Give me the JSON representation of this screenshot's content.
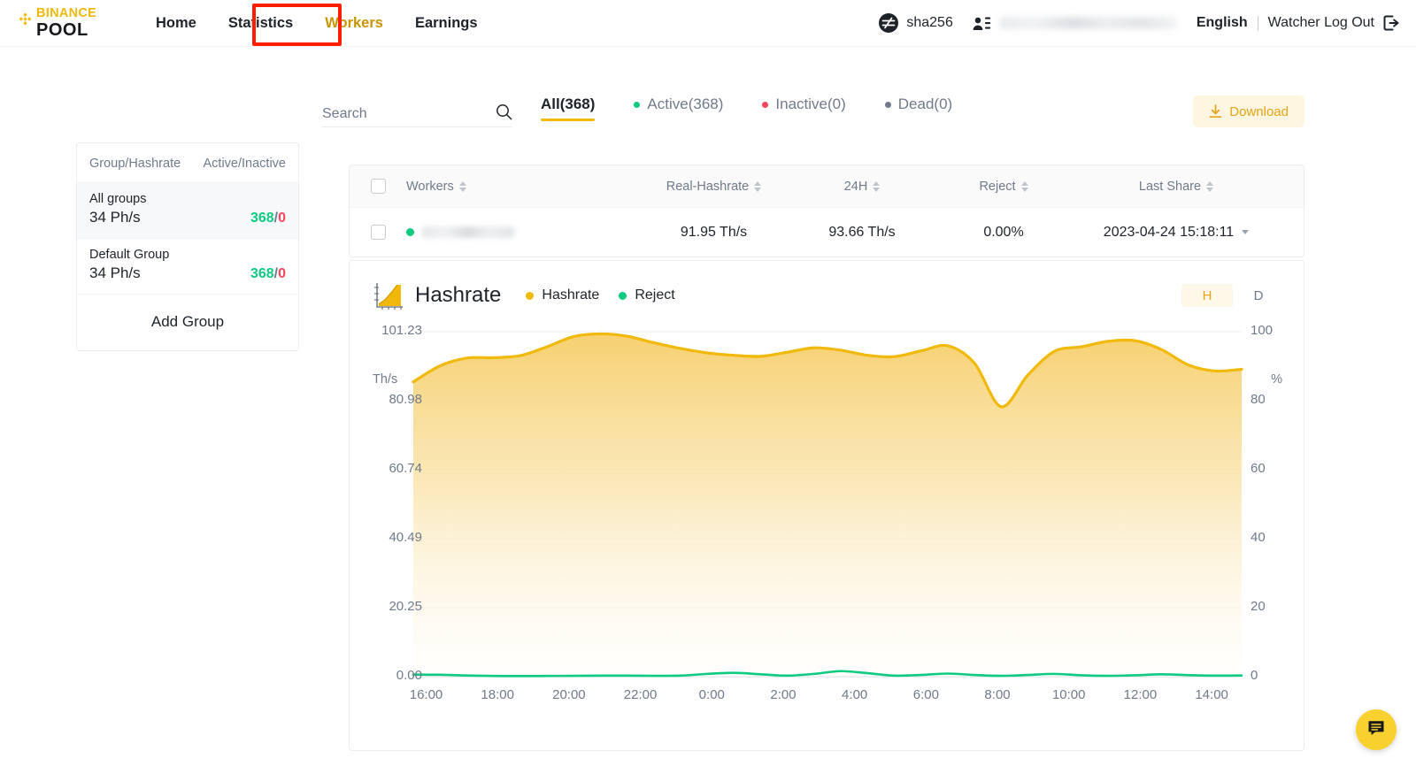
{
  "header": {
    "logo_top": "BINANCE",
    "logo_bottom": "POOL",
    "nav": [
      {
        "label": "Home",
        "active": false
      },
      {
        "label": "Statistics",
        "active": false
      },
      {
        "label": "Workers",
        "active": true
      },
      {
        "label": "Earnings",
        "active": false
      }
    ],
    "algorithm": "sha256",
    "account_masked": "",
    "language": "English",
    "logout": "Watcher Log Out",
    "highlight_color": "#FF1E00"
  },
  "toolbar": {
    "search_placeholder": "Search",
    "search_value": "",
    "tabs": [
      {
        "label": "All(368)",
        "dot": null,
        "active": true
      },
      {
        "label": "Active(368)",
        "dot": "#0ECB81",
        "active": false
      },
      {
        "label": "Inactive(0)",
        "dot": "#F6465D",
        "active": false
      },
      {
        "label": "Dead(0)",
        "dot": "#707a8a",
        "active": false
      }
    ],
    "download_label": "Download"
  },
  "sidebar": {
    "col_group": "Group/Hashrate",
    "col_active": "Active/Inactive",
    "groups": [
      {
        "name": "All groups",
        "hashrate": "34 Ph/s",
        "active": "368",
        "inactive": "0",
        "selected": true
      },
      {
        "name": "Default Group",
        "hashrate": "34 Ph/s",
        "active": "368",
        "inactive": "0",
        "selected": false
      }
    ],
    "add_group_label": "Add Group"
  },
  "table": {
    "columns": [
      "Workers",
      "Real-Hashrate",
      "24H",
      "Reject",
      "Last Share"
    ],
    "rows": [
      {
        "status": "active",
        "worker": "",
        "real_hashrate": "91.95 Th/s",
        "h24": "93.66 Th/s",
        "reject": "0.00%",
        "last_share": "2023-04-24 15:18:11"
      }
    ]
  },
  "chart_panel": {
    "title": "Hashrate",
    "legend": [
      {
        "label": "Hashrate",
        "color": "#F0B90B"
      },
      {
        "label": "Reject",
        "color": "#0ECB81"
      }
    ],
    "granularity": [
      {
        "label": "H",
        "active": true
      },
      {
        "label": "D",
        "active": false
      }
    ]
  },
  "chart_data": {
    "type": "area",
    "title": "Hashrate",
    "xlabel": "",
    "ylabel": "Th/s",
    "y2label": "%",
    "ylim": [
      0,
      101.23
    ],
    "y2lim": [
      0,
      100
    ],
    "grid": true,
    "legend_position": "top-left",
    "yticks": [
      "0.00",
      "20.25",
      "40.49",
      "60.74",
      "80.98",
      "101.23"
    ],
    "y2ticks": [
      "0",
      "20",
      "40",
      "60",
      "80",
      "100"
    ],
    "xticks": [
      "16:00",
      "18:00",
      "20:00",
      "22:00",
      "0:00",
      "2:00",
      "4:00",
      "6:00",
      "8:00",
      "10:00",
      "12:00",
      "14:00"
    ],
    "x": [
      16,
      17,
      18,
      19,
      20,
      21,
      22,
      23,
      24,
      25,
      26,
      27,
      28,
      29,
      30,
      31,
      32,
      33,
      34,
      35,
      36,
      37,
      38,
      39,
      40,
      41,
      42,
      43,
      44,
      45,
      46,
      47
    ],
    "series": [
      {
        "name": "Hashrate",
        "color": "#F0B90B",
        "unit": "Th/s",
        "axis": "left",
        "values": [
          86.5,
          91.2,
          93.5,
          93.6,
          94.2,
          96.8,
          99.8,
          100.6,
          99.9,
          98.0,
          96.3,
          95.0,
          94.3,
          94.0,
          95.2,
          96.5,
          95.8,
          94.3,
          93.9,
          95.6,
          97.1,
          92.0,
          79.2,
          88.5,
          95.5,
          96.8,
          98.4,
          98.6,
          96.0,
          91.5,
          89.7,
          90.2
        ]
      },
      {
        "name": "Reject",
        "color": "#0ECB81",
        "unit": "%",
        "axis": "right",
        "values": [
          0.6,
          0.55,
          0.35,
          0.2,
          0.18,
          0.2,
          0.25,
          0.3,
          0.3,
          0.25,
          0.3,
          0.8,
          1.1,
          0.7,
          0.3,
          0.8,
          1.6,
          1.0,
          0.3,
          0.5,
          0.9,
          0.5,
          0.25,
          0.5,
          0.8,
          0.4,
          0.25,
          0.4,
          0.7,
          0.45,
          0.3,
          0.35
        ]
      }
    ]
  },
  "chat": {
    "label": "support-chat"
  }
}
